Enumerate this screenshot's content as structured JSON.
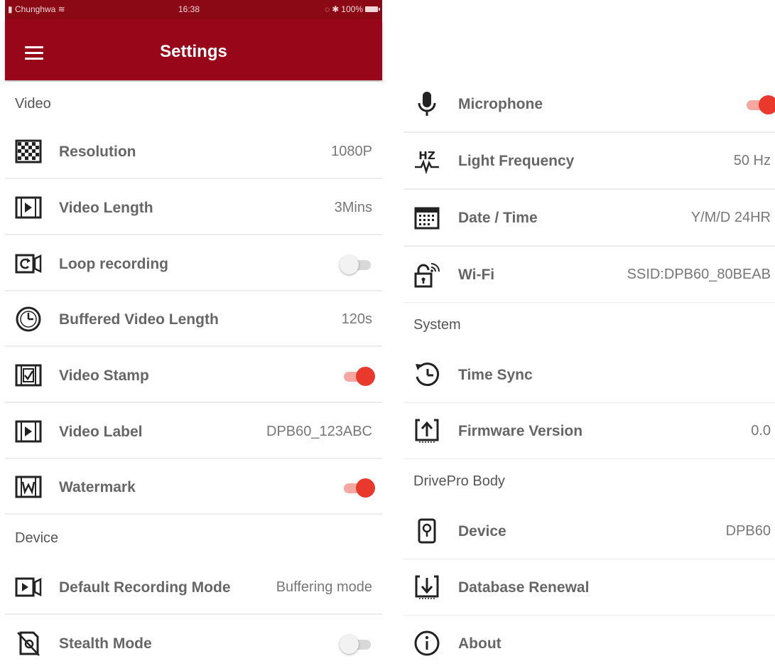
{
  "status_bar": {
    "carrier": "Chunghwa",
    "time": "16:38",
    "battery": "100%"
  },
  "app_bar": {
    "title": "Settings"
  },
  "left": {
    "video_header": "Video",
    "device_header": "Device",
    "rows": {
      "resolution": {
        "label": "Resolution",
        "value": "1080P"
      },
      "video_length": {
        "label": "Video Length",
        "value": "3Mins"
      },
      "loop_recording": {
        "label": "Loop recording",
        "on": false
      },
      "buffered_length": {
        "label": "Buffered Video Length",
        "value": "120s"
      },
      "video_stamp": {
        "label": "Video Stamp",
        "on": true
      },
      "video_label": {
        "label": "Video Label",
        "value": "DPB60_123ABC"
      },
      "watermark": {
        "label": "Watermark",
        "on": true
      },
      "default_mode": {
        "label": "Default Recording Mode",
        "value": "Buffering mode"
      },
      "stealth_mode": {
        "label": "Stealth Mode",
        "on": false
      }
    }
  },
  "right": {
    "system_header": "System",
    "body_header": "DrivePro Body",
    "rows": {
      "microphone": {
        "label": "Microphone",
        "on": true
      },
      "light_frequency": {
        "label": "Light Frequency",
        "value": "50 Hz"
      },
      "date_time": {
        "label": "Date / Time",
        "value": "Y/M/D 24HR"
      },
      "wifi": {
        "label": "Wi-Fi",
        "value": "SSID:DPB60_80BEAB"
      },
      "time_sync": {
        "label": "Time Sync"
      },
      "firmware": {
        "label": "Firmware Version",
        "value": "0.0"
      },
      "device": {
        "label": "Device",
        "value": "DPB60"
      },
      "database_renewal": {
        "label": "Database Renewal"
      },
      "about": {
        "label": "About"
      }
    }
  },
  "colors": {
    "brand": "#98061a",
    "toggle_on": "#e8392c"
  },
  "icons": {
    "resolution": "checkerboard-icon",
    "video_length": "film-play-icon",
    "loop_recording": "loop-camera-icon",
    "buffered_length": "clock-icon",
    "video_stamp": "film-check-icon",
    "video_label": "film-play-icon",
    "watermark": "film-w-icon",
    "default_mode": "video-camera-icon",
    "stealth_mode": "stealth-icon",
    "microphone": "microphone-icon",
    "light_frequency": "hz-wave-icon",
    "date_time": "calendar-icon",
    "wifi": "wifi-lock-icon",
    "time_sync": "clock-sync-icon",
    "firmware": "upload-icon",
    "device": "device-icon",
    "database_renewal": "download-icon",
    "about": "info-icon"
  }
}
